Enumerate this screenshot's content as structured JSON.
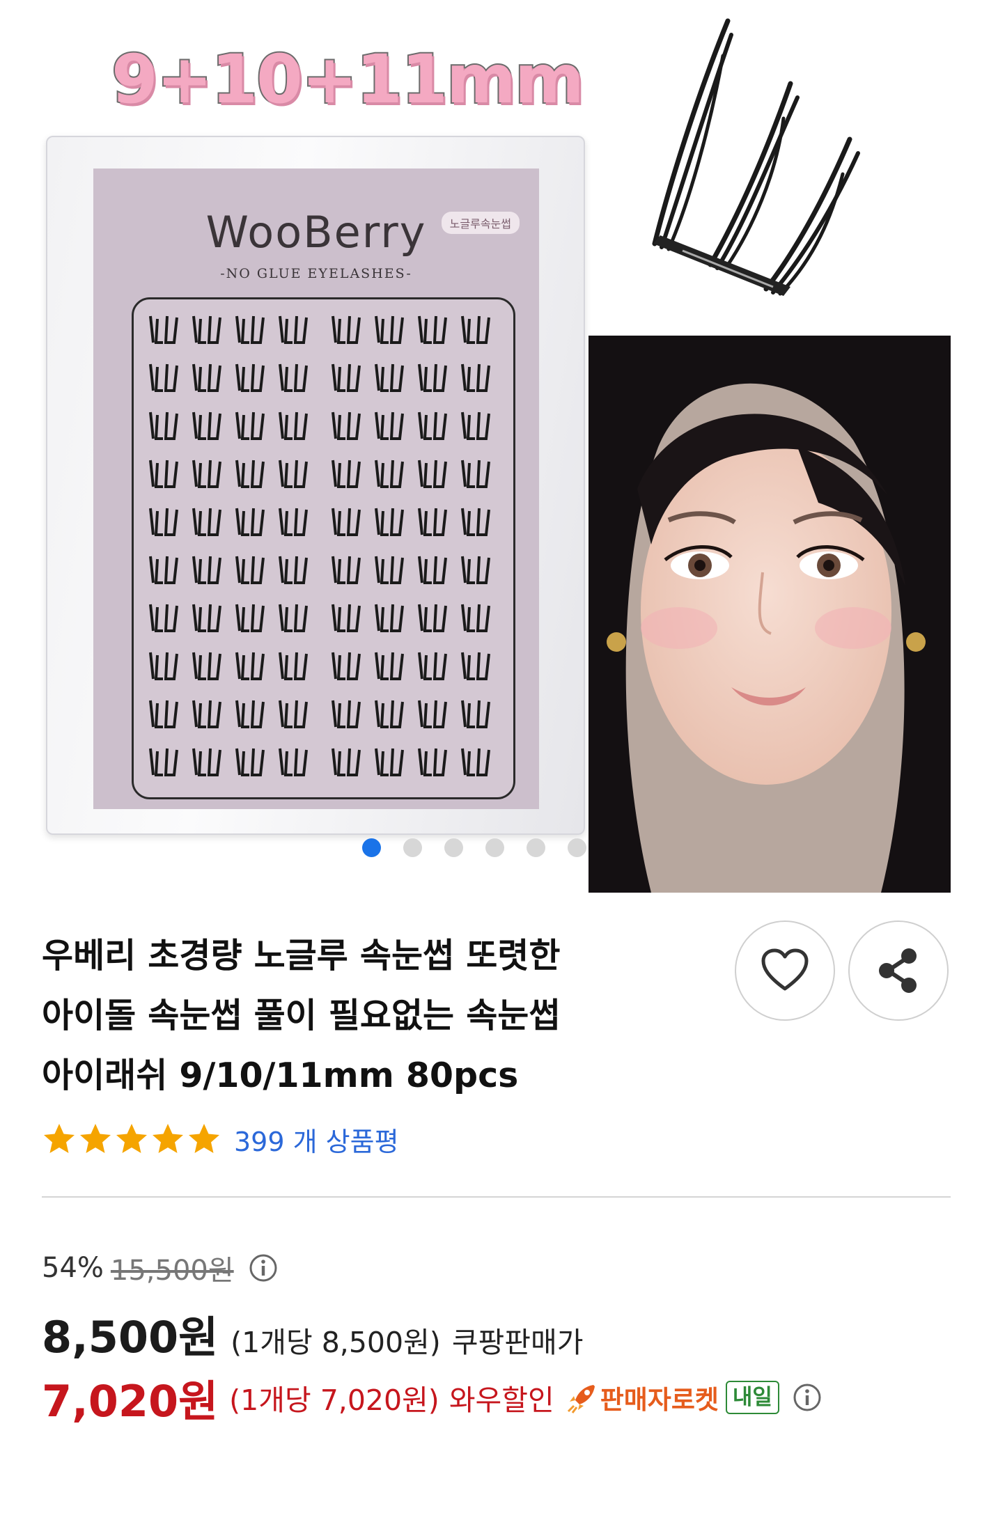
{
  "hero": {
    "headline": "9+10+11mm",
    "brand_name": "WooBerry",
    "brand_subtitle": "-NO GLUE EYELASHES-",
    "brand_tag": "노글루속눈썹",
    "carousel": {
      "count": 6,
      "active_index": 0
    }
  },
  "product": {
    "title_lines": [
      "우베리 초경량 노글루 속눈썹 또렷한",
      "아이돌 속눈썹 풀이 필요없는 속눈썹",
      "아이래쉬 9/10/11mm 80pcs"
    ],
    "rating_stars": 5,
    "review_count_text": "399 개 상품평"
  },
  "actions": {
    "like_icon": "heart-icon",
    "share_icon": "share-icon"
  },
  "price": {
    "discount_percent": "54%",
    "original_price": "15,500원",
    "sale_price": "8,500원",
    "unit_price": "(1개당 8,500원)",
    "seller_price_label": "쿠팡판매가",
    "wow_price": "7,020원",
    "wow_unit_price": "(1개당 7,020원)",
    "wow_label": "와우할인",
    "rocket_label": "판매자로켓",
    "delivery_badge": "내일"
  },
  "colors": {
    "accent_blue": "#1a73e8",
    "review_link": "#2b68d9",
    "wow_red": "#c6161d",
    "rocket_orange": "#e65c1c",
    "delivery_green": "#2d8a37",
    "star_orange": "#f5a400"
  }
}
